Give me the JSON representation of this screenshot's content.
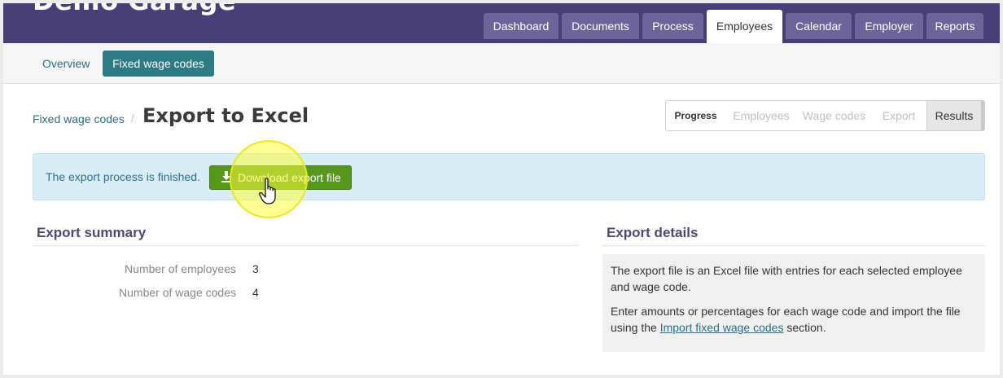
{
  "app": {
    "brand": "Demo Garage"
  },
  "main_tabs": [
    {
      "label": "Dashboard",
      "active": false
    },
    {
      "label": "Documents",
      "active": false
    },
    {
      "label": "Process",
      "active": false
    },
    {
      "label": "Employees",
      "active": true
    },
    {
      "label": "Calendar",
      "active": false
    },
    {
      "label": "Employer",
      "active": false
    },
    {
      "label": "Reports",
      "active": false
    }
  ],
  "sub_nav": {
    "overview": "Overview",
    "fixed_wage_codes": "Fixed wage codes"
  },
  "breadcrumb": {
    "parent": "Fixed wage codes",
    "separator": "/",
    "title": "Export to Excel"
  },
  "progress": {
    "label": "Progress",
    "steps": [
      "Employees",
      "Wage codes",
      "Export",
      "Results"
    ],
    "current": "Results"
  },
  "alert": {
    "text": "The export process is finished.",
    "button": "Download export file"
  },
  "summary": {
    "heading": "Export summary",
    "rows": [
      {
        "label": "Number of employees",
        "value": "3"
      },
      {
        "label": "Number of wage codes",
        "value": "4"
      }
    ]
  },
  "details": {
    "heading": "Export details",
    "p1": "The export file is an Excel file with entries for each selected employee and wage code.",
    "p2_before": "Enter amounts or percentages for each wage code and import the file using the ",
    "p2_link": "Import fixed wage codes",
    "p2_after": " section."
  },
  "colors": {
    "header": "#473f75",
    "tab": "#6d6499",
    "accent": "#2e7b85",
    "download": "#56981c",
    "alert_bg": "#d8edf5"
  },
  "icons": [
    "download-icon",
    "hand-cursor-icon"
  ]
}
